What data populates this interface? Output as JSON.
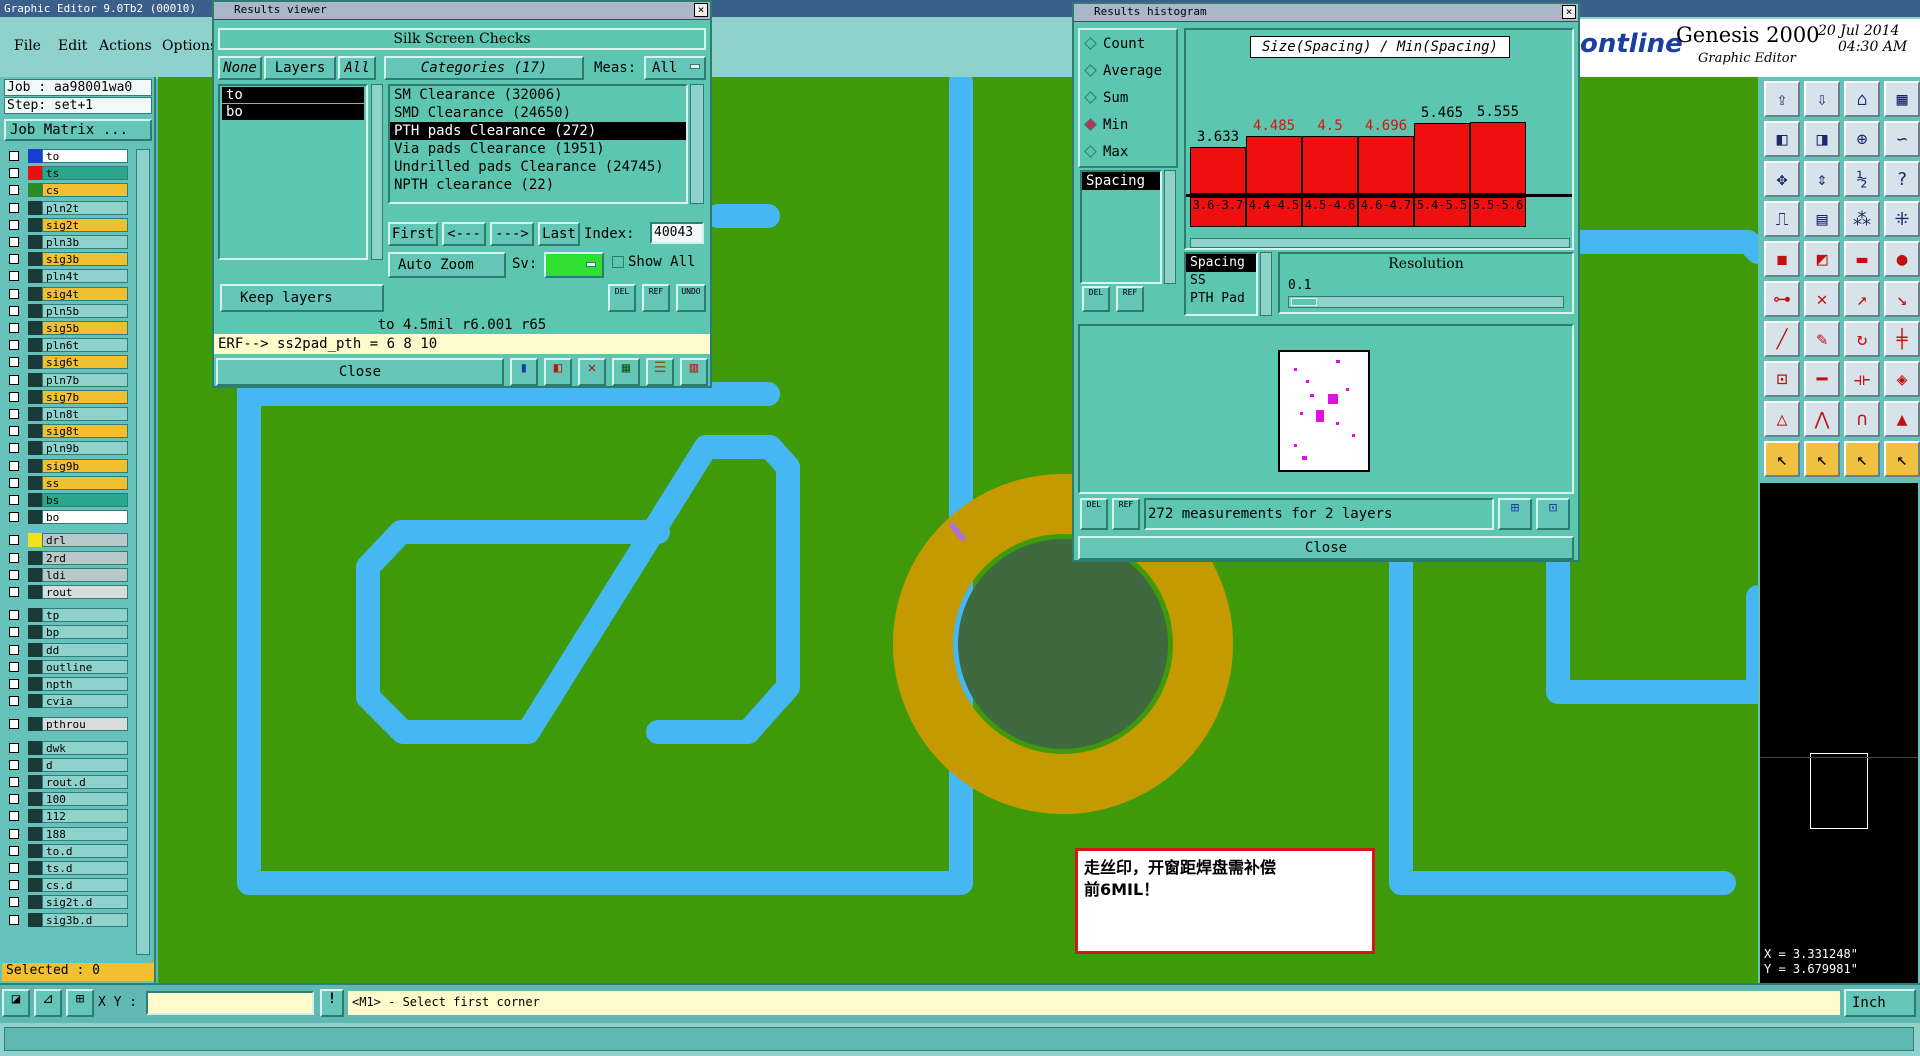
{
  "app_title": "Graphic Editor 9.0Tb2 (00010)",
  "menu": [
    "File",
    "Edit",
    "Actions",
    "Options"
  ],
  "brand": {
    "logo_fragment": "ontline",
    "product": "Genesis 2000",
    "subtitle": "Graphic Editor",
    "date": "20 Jul 2014",
    "time": "04:30 AM"
  },
  "job": {
    "job_line": "Job : aa98001wa0",
    "step_line": "Step: set+1",
    "matrix_button": "Job Matrix ..."
  },
  "layers": [
    {
      "name": "to",
      "bg": "#ffffff",
      "swatch": "#1a3fd0"
    },
    {
      "name": "ts",
      "bg": "#2aa88c",
      "swatch": "#e81010"
    },
    {
      "name": "cs",
      "bg": "#f0c030",
      "swatch": "#2a8a2a"
    },
    {
      "name": "pln2t",
      "bg": "#8fd2cc",
      "swatch": "#1a3a3a"
    },
    {
      "name": "sig2t",
      "bg": "#f0c030",
      "swatch": "#1a3a3a"
    },
    {
      "name": "pln3b",
      "bg": "#8fd2cc",
      "swatch": "#1a3a3a"
    },
    {
      "name": "sig3b",
      "bg": "#f0c030",
      "swatch": "#1a3a3a"
    },
    {
      "name": "pln4t",
      "bg": "#8fd2cc",
      "swatch": "#1a3a3a"
    },
    {
      "name": "sig4t",
      "bg": "#f0c030",
      "swatch": "#1a3a3a"
    },
    {
      "name": "pln5b",
      "bg": "#8fd2cc",
      "swatch": "#1a3a3a"
    },
    {
      "name": "sig5b",
      "bg": "#f0c030",
      "swatch": "#1a3a3a"
    },
    {
      "name": "pln6t",
      "bg": "#8fd2cc",
      "swatch": "#1a3a3a"
    },
    {
      "name": "sig6t",
      "bg": "#f0c030",
      "swatch": "#1a3a3a"
    },
    {
      "name": "pln7b",
      "bg": "#8fd2cc",
      "swatch": "#1a3a3a"
    },
    {
      "name": "sig7b",
      "bg": "#f0c030",
      "swatch": "#1a3a3a"
    },
    {
      "name": "pln8t",
      "bg": "#8fd2cc",
      "swatch": "#1a3a3a"
    },
    {
      "name": "sig8t",
      "bg": "#f0c030",
      "swatch": "#1a3a3a"
    },
    {
      "name": "pln9b",
      "bg": "#8fd2cc",
      "swatch": "#1a3a3a"
    },
    {
      "name": "sig9b",
      "bg": "#f0c030",
      "swatch": "#1a3a3a"
    },
    {
      "name": "ss",
      "bg": "#f0c030",
      "swatch": "#1a3a3a"
    },
    {
      "name": "bs",
      "bg": "#2aa88c",
      "swatch": "#1a3a3a"
    },
    {
      "name": "bo",
      "bg": "#ffffff",
      "swatch": "#1a3a3a"
    },
    {
      "name": "drl",
      "bg": "#b8c8c8",
      "swatch": "#f0e020"
    },
    {
      "name": "2rd",
      "bg": "#b8c8c8",
      "swatch": "#1a3a3a"
    },
    {
      "name": "ldi",
      "bg": "#b8c8c8",
      "swatch": "#1a3a3a"
    },
    {
      "name": "rout",
      "bg": "#d8dcdc",
      "swatch": "#1a3a3a"
    },
    {
      "name": "tp",
      "bg": "#8fd2cc",
      "swatch": "#1a3a3a"
    },
    {
      "name": "bp",
      "bg": "#8fd2cc",
      "swatch": "#1a3a3a"
    },
    {
      "name": "dd",
      "bg": "#8fd2cc",
      "swatch": "#1a3a3a"
    },
    {
      "name": "outline",
      "bg": "#8fd2cc",
      "swatch": "#1a3a3a"
    },
    {
      "name": "npth",
      "bg": "#8fd2cc",
      "swatch": "#1a3a3a"
    },
    {
      "name": "cvia",
      "bg": "#8fd2cc",
      "swatch": "#1a3a3a"
    },
    {
      "name": "pthrou",
      "bg": "#d8dcdc",
      "swatch": "#1a3a3a"
    },
    {
      "name": "dwk",
      "bg": "#8fd2cc",
      "swatch": "#1a3a3a"
    },
    {
      "name": "d",
      "bg": "#8fd2cc",
      "swatch": "#1a3a3a"
    },
    {
      "name": "rout.d",
      "bg": "#8fd2cc",
      "swatch": "#1a3a3a"
    },
    {
      "name": "100",
      "bg": "#8fd2cc",
      "swatch": "#1a3a3a"
    },
    {
      "name": "112",
      "bg": "#8fd2cc",
      "swatch": "#1a3a3a"
    },
    {
      "name": "188",
      "bg": "#8fd2cc",
      "swatch": "#1a3a3a"
    },
    {
      "name": "to.d",
      "bg": "#8fd2cc",
      "swatch": "#1a3a3a"
    },
    {
      "name": "ts.d",
      "bg": "#8fd2cc",
      "swatch": "#1a3a3a"
    },
    {
      "name": "cs.d",
      "bg": "#8fd2cc",
      "swatch": "#1a3a3a"
    },
    {
      "name": "sig2t.d",
      "bg": "#8fd2cc",
      "swatch": "#1a3a3a"
    },
    {
      "name": "sig3b.d",
      "bg": "#8fd2cc",
      "swatch": "#1a3a3a"
    }
  ],
  "selected_line": "Selected : 0",
  "results_viewer": {
    "title": "Results viewer",
    "header": "Silk Screen Checks",
    "none_btn": "None",
    "layers_btn": "Layers",
    "all_btn": "All",
    "categories_btn": "Categories (17)",
    "meas_label": "Meas:",
    "meas_value": "All",
    "layer_list": [
      "to",
      "bo"
    ],
    "categories": [
      "SM Clearance (32006)",
      "SMD Clearance (24650)",
      "PTH pads Clearance (272)",
      "Via pads Clearance (1951)",
      "Undrilled pads Clearance (24745)",
      "NPTH clearance (22)"
    ],
    "first_btn": "First",
    "prev_btn": "<---",
    "next_btn": "--->",
    "last_btn": "Last",
    "index_label": "Index:",
    "index_value": "40043",
    "auto_zoom": "Auto Zoom",
    "sv_label": "Sv:",
    "show_all": "Show All",
    "keep_layers": "Keep layers",
    "del": "DEL",
    "ref": "REF",
    "undo": "UNDO",
    "measure_line": "to 4.5mil  r6.001  r65",
    "erf_line": "ERF--> ss2pad_pth = 6 8 10",
    "close": "Close"
  },
  "histogram": {
    "title": "Results histogram",
    "stats": [
      "Count",
      "Average",
      "Sum",
      "Min",
      "Max"
    ],
    "stat_selected": "Min",
    "chart_title": "Size(Spacing) / Min(Spacing)",
    "param_list": [
      "Spacing"
    ],
    "bars": [
      {
        "value": "3.633",
        "range": "3.6-3.7",
        "ratio": 0.65,
        "red_label": false
      },
      {
        "value": "4.485",
        "range": "4.4-4.5",
        "ratio": 0.8,
        "red_label": true
      },
      {
        "value": "4.5",
        "range": "4.5-4.6",
        "ratio": 0.8,
        "red_label": true
      },
      {
        "value": "4.696",
        "range": "4.6-4.7",
        "ratio": 0.8,
        "red_label": true
      },
      {
        "value": "5.465",
        "range": "5.4-5.5",
        "ratio": 0.98,
        "red_label": false
      },
      {
        "value": "5.555",
        "range": "5.5-5.6",
        "ratio": 1.0,
        "red_label": false
      }
    ],
    "type_list": [
      "Spacing",
      "SS",
      "PTH Pad"
    ],
    "resolution_label": "Resolution",
    "resolution_value": "0.1",
    "del": "DEL",
    "ref": "REF",
    "summary": "272 measurements for 2 layers",
    "close": "Close"
  },
  "note": {
    "line1": "走丝印，开窗距焊盘需补偿",
    "line2": "前6MIL！"
  },
  "coords": {
    "x": "X = 3.331248\"",
    "y": "Y = 3.679981\""
  },
  "status": {
    "xy_label": "X Y :",
    "prompt": "<M1> - Select first corner",
    "units": "Inch"
  }
}
